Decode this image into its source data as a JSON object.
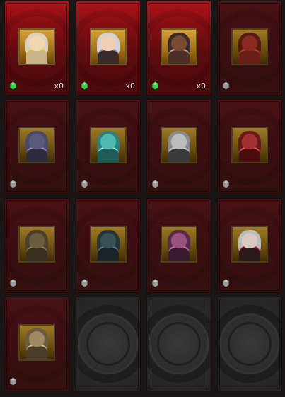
{
  "cards": [
    {
      "id": "c1",
      "state": "owned",
      "hero": "golden-masked-warrior",
      "count": "x0",
      "gem": "green",
      "fig": {
        "hair": "#d8d0c0",
        "head": "#f1d7b0",
        "body": "#c9b48a",
        "accent": "#e4c23a"
      }
    },
    {
      "id": "c2",
      "state": "owned",
      "hero": "silver-haired-elf",
      "count": "x0",
      "gem": "green",
      "fig": {
        "hair": "#cfd2d8",
        "head": "#f0cfb5",
        "body": "#3a2a2a",
        "accent": "#8b8f99"
      }
    },
    {
      "id": "c3",
      "state": "owned",
      "hero": "dark-armored-knight",
      "count": "x0",
      "gem": "green",
      "fig": {
        "hair": "#3a2b27",
        "head": "#7a4a33",
        "body": "#4a3028",
        "accent": "#c7a97a"
      }
    },
    {
      "id": "c4",
      "state": "locked",
      "hero": "red-imp-demon",
      "gem": "grey",
      "fig": {
        "hair": "#5a1a14",
        "head": "#8a2a20",
        "body": "#6b1e18",
        "accent": "#b5432e"
      }
    },
    {
      "id": "c5",
      "state": "locked",
      "hero": "hooded-purple-mage",
      "gem": "grey",
      "fig": {
        "hair": "#4a4a6a",
        "head": "#5a5a7a",
        "body": "#2e2b3e",
        "accent": "#8c8cb0"
      }
    },
    {
      "id": "c6",
      "state": "locked",
      "hero": "crystal-orb",
      "gem": "grey",
      "fig": {
        "hair": "#2f7f7a",
        "head": "#4fb8b0",
        "body": "#1f5c58",
        "accent": "#8fe0d8"
      }
    },
    {
      "id": "c7",
      "state": "locked",
      "hero": "winged-skull-reaper",
      "gem": "grey",
      "fig": {
        "hair": "#8a8a8a",
        "head": "#bdbdbd",
        "body": "#3a3a3a",
        "accent": "#d0d0d0"
      }
    },
    {
      "id": "c8",
      "state": "locked",
      "hero": "crimson-robed-sorcerer",
      "gem": "grey",
      "fig": {
        "hair": "#6a1a1a",
        "head": "#a23030",
        "body": "#4a0e0e",
        "accent": "#d45a5a"
      }
    },
    {
      "id": "c9",
      "state": "locked",
      "hero": "stone-serpent-beast",
      "gem": "grey",
      "fig": {
        "hair": "#4a4030",
        "head": "#6a5c40",
        "body": "#3a3020",
        "accent": "#8a7a55"
      }
    },
    {
      "id": "c10",
      "state": "locked",
      "hero": "shadow-dark-knight",
      "gem": "grey",
      "fig": {
        "hair": "#23343a",
        "head": "#3a5058",
        "body": "#1a2428",
        "accent": "#5a7a84"
      }
    },
    {
      "id": "c11",
      "state": "locked",
      "hero": "purple-spiked-witch",
      "gem": "grey",
      "fig": {
        "hair": "#5a2a4a",
        "head": "#9a5080",
        "body": "#3a1a30",
        "accent": "#c07aa8"
      }
    },
    {
      "id": "c12",
      "state": "locked",
      "hero": "white-haired-vampire",
      "gem": "grey",
      "fig": {
        "hair": "#bcbcbc",
        "head": "#d8c8c0",
        "body": "#2a1a1a",
        "accent": "#8a1a1a"
      }
    },
    {
      "id": "c13",
      "state": "locked",
      "hero": "armored-beast-lord",
      "gem": "grey",
      "fig": {
        "hair": "#6a5a40",
        "head": "#a08a64",
        "body": "#4a3c28",
        "accent": "#c8b488"
      }
    },
    {
      "id": "c14",
      "state": "empty"
    },
    {
      "id": "c15",
      "state": "empty"
    },
    {
      "id": "c16",
      "state": "empty"
    }
  ],
  "colors": {
    "gem_green": "#3fd14a",
    "gem_grey": "#9a9a9a"
  }
}
